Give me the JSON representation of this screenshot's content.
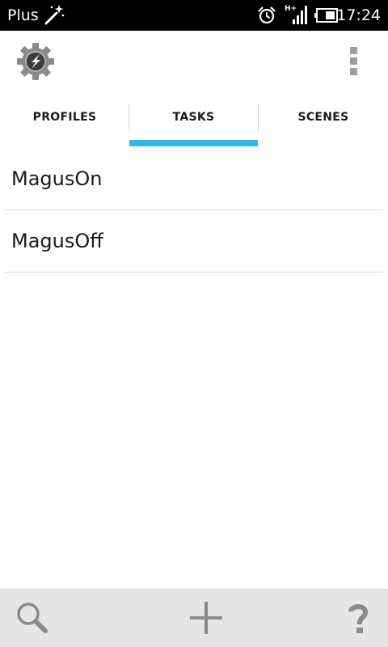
{
  "status_bar": {
    "carrier": "Plus",
    "network_type": "H+",
    "time": "17:24",
    "icons": [
      "magic-wand-icon",
      "alarm-icon",
      "signal-icon",
      "battery-icon"
    ]
  },
  "action_bar": {
    "app_icon": "tasker-gear-icon",
    "menu_icon": "overflow-menu-icon"
  },
  "tabs": [
    {
      "label": "PROFILES",
      "selected": false
    },
    {
      "label": "TASKS",
      "selected": true
    },
    {
      "label": "SCENES",
      "selected": false
    }
  ],
  "tasks": [
    {
      "label": "MagusOn"
    },
    {
      "label": "MagusOff"
    }
  ],
  "bottom_bar": {
    "icons": [
      "search-icon",
      "add-icon",
      "help-icon"
    ]
  },
  "colors": {
    "accent": "#33b5e5",
    "status_bar": "#000000",
    "bottom_bar": "#e6e6e6",
    "icon_gray": "#9e9e9e"
  }
}
